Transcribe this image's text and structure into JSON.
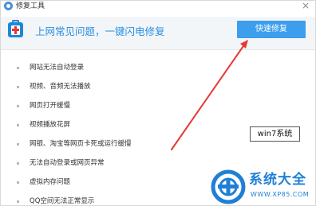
{
  "window": {
    "title": "修复工具",
    "close_glyph": "×"
  },
  "header": {
    "headline": "上网常见问题，一键闪电修复",
    "quick_fix_label": "快速修复"
  },
  "issues": [
    "网站无法自动登录",
    "视频、音频无法播放",
    "网页打开缓慢",
    "视频播放花屏",
    "网银、淘宝等网页卡死或运行缓慢",
    "无法自动登录或网页异常",
    "虚拟内存问题",
    "QQ空间无法正常显示"
  ],
  "annotation": {
    "tag": "win7系统"
  },
  "watermark": {
    "title": "系统大全",
    "url": "WWW.XP85.COM"
  },
  "colors": {
    "accent": "#3c9eec",
    "headline": "#2a8fe0",
    "arrow": "#e53935",
    "watermark": "#1f7fd6"
  }
}
